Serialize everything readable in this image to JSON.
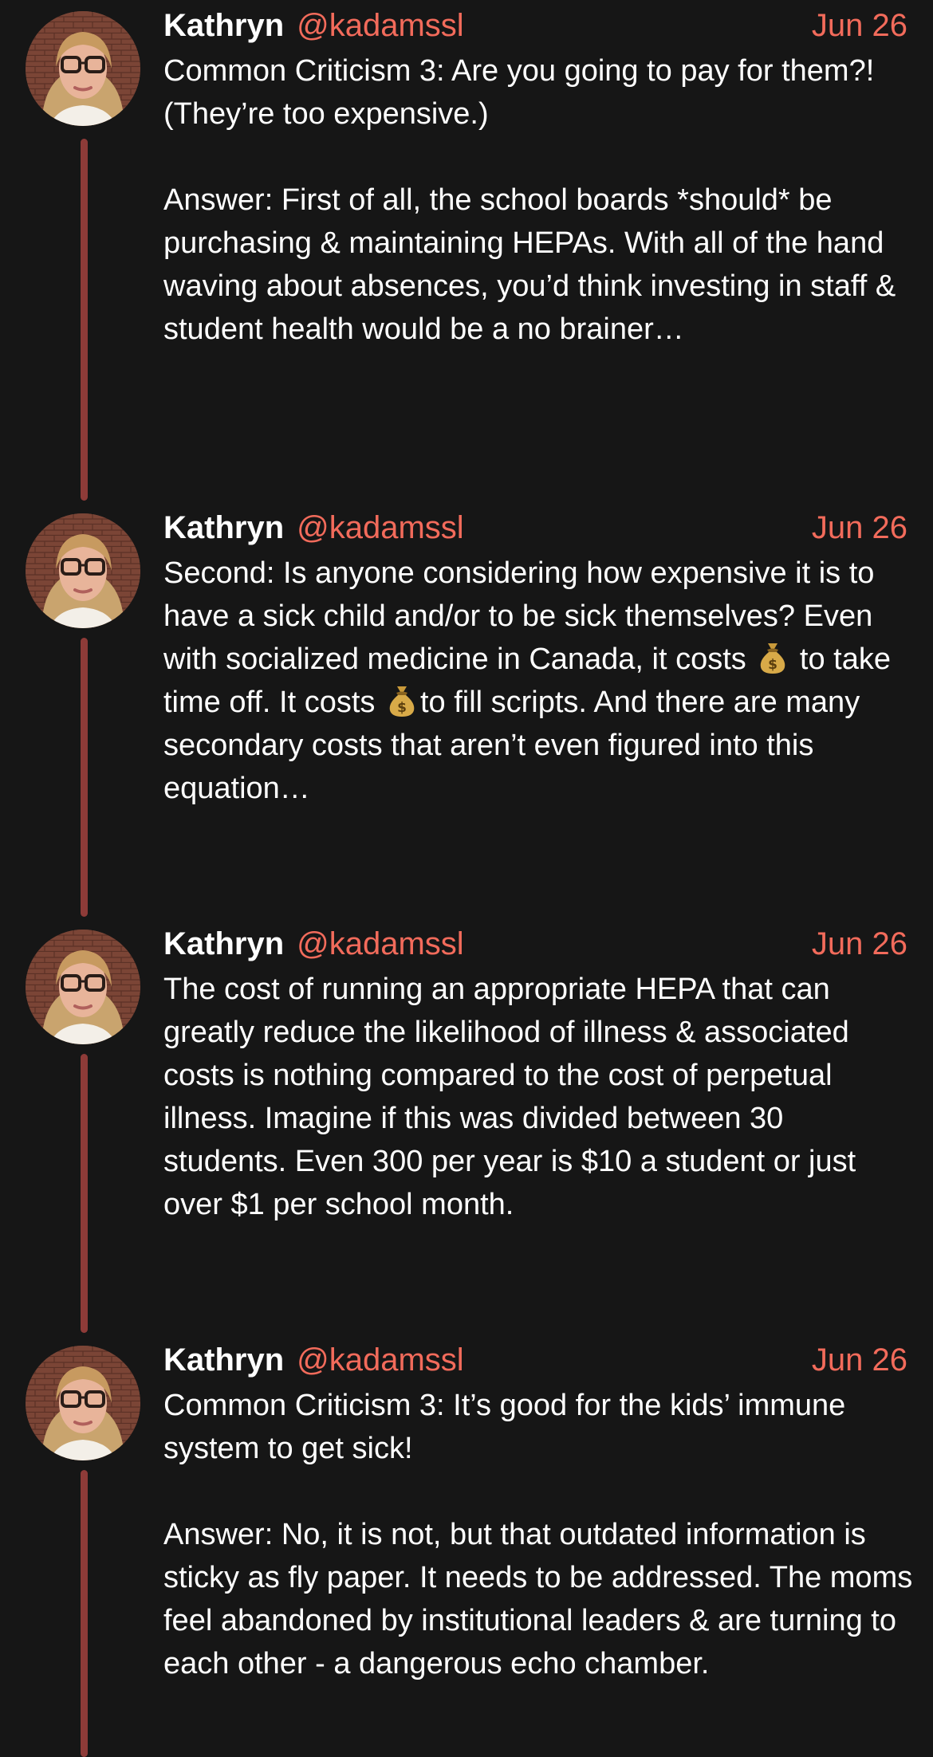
{
  "tweets": [
    {
      "name": "Kathryn",
      "handle": "@kadamssl",
      "date": "Jun 26",
      "text": "Common Criticism 3: Are you going to pay for them?! (They’re too expensive.)\n\nAnswer: First of all, the school boards *should* be purchasing & maintaining HEPAs. With all of the hand waving about absences, you’d think investing in staff & student health would be a no brainer…"
    },
    {
      "name": "Kathryn",
      "handle": "@kadamssl",
      "date": "Jun 26",
      "text_parts": [
        "Second: Is anyone considering how expensive it is to have a sick child and/or to be sick themselves? Even with socialized medicine in Canada, it costs",
        "to take time off. It costs",
        "to fill scripts. And there are many secondary costs that aren’t even figured into this equation…"
      ],
      "emoji": "money-bag"
    },
    {
      "name": "Kathryn",
      "handle": "@kadamssl",
      "date": "Jun 26",
      "text": "The cost of running an appropriate HEPA that can greatly reduce the likelihood of illness & associated costs is nothing compared to the cost of perpetual illness. Imagine if this was divided between 30 students. Even 300 per year is $10 a student or just over $1 per school month."
    },
    {
      "name": "Kathryn",
      "handle": "@kadamssl",
      "date": "Jun 26",
      "text": "Common Criticism 3: It’s good for the kids’ immune system to get sick!\n\nAnswer: No, it is not, but that outdated information is sticky as fly paper. It needs to be addressed. The moms feel abandoned by institutional leaders & are turning to each other - a dangerous echo chamber."
    }
  ],
  "colors": {
    "background": "#161616",
    "accent": "#f26b5b",
    "thread_line": "#8e3b38",
    "text": "#ffffff"
  }
}
